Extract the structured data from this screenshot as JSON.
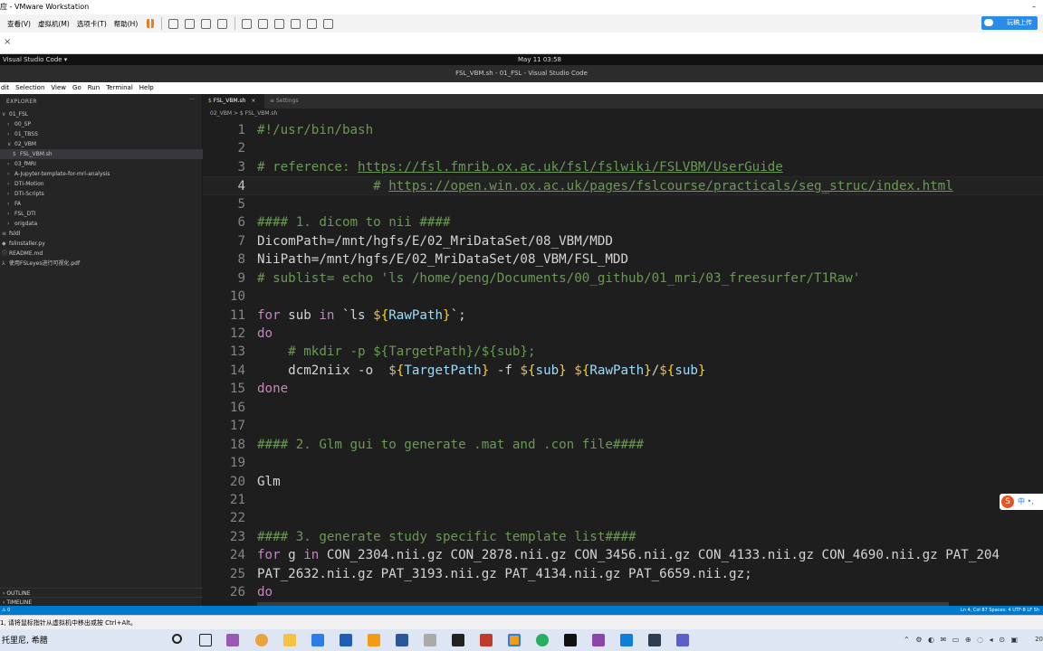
{
  "vmware": {
    "title": "应 - VMware Workstation",
    "menus": [
      "查看(V)",
      "虚拟机(M)",
      "选项卡(T)",
      "帮助(H)"
    ],
    "upload_label": "玩稿上传",
    "minimize": "–",
    "status_text": "1, 请将鼠标指针从虚拟机中移出或按 Ctrl+Alt。",
    "close_tab": "×"
  },
  "gnome": {
    "app": "Visual Studio Code ▾",
    "clock": "May 11  03:58"
  },
  "vscode": {
    "window_title": "FSL_VBM.sh - 01_FSL - Visual Studio Code",
    "menu": [
      "dit",
      "Selection",
      "View",
      "Go",
      "Run",
      "Terminal",
      "Help"
    ],
    "explorer_title": "EXPLORER",
    "explorer_more": "···",
    "tree": [
      {
        "chev": "∨",
        "label": "01_FSL",
        "indent": 0,
        "selected": false
      },
      {
        "chev": "›",
        "label": "00_SP",
        "indent": 1,
        "selected": false
      },
      {
        "chev": "›",
        "label": "01_TBSS",
        "indent": 1,
        "selected": false
      },
      {
        "chev": "∨",
        "label": "02_VBM",
        "indent": 1,
        "selected": false
      },
      {
        "chev": "$",
        "label": "FSL_VBM.sh",
        "indent": 2,
        "selected": true
      },
      {
        "chev": "›",
        "label": "03_fMRI",
        "indent": 1,
        "selected": false
      },
      {
        "chev": "›",
        "label": "A-Jupyter-template-for-mri-analysis",
        "indent": 1,
        "selected": false
      },
      {
        "chev": "›",
        "label": "DTI-Motion",
        "indent": 1,
        "selected": false
      },
      {
        "chev": "›",
        "label": "DTI-Scripts",
        "indent": 1,
        "selected": false
      },
      {
        "chev": "›",
        "label": "FA",
        "indent": 1,
        "selected": false
      },
      {
        "chev": "›",
        "label": "FSL_DTI",
        "indent": 1,
        "selected": false
      },
      {
        "chev": "›",
        "label": "origdata",
        "indent": 1,
        "selected": false
      },
      {
        "chev": "≡",
        "label": "fsldl",
        "indent": 0,
        "selected": false
      },
      {
        "chev": "◆",
        "label": "fslinstaller.py",
        "indent": 0,
        "selected": false
      },
      {
        "chev": "ⓘ",
        "label": "README.md",
        "indent": 0,
        "selected": false
      },
      {
        "chev": "⅄",
        "label": "使用FSLeyes进行可视化.pdf",
        "indent": 0,
        "selected": false
      }
    ],
    "outline_label": "OUTLINE",
    "timeline_label": "TIMELINE",
    "tabs": [
      {
        "label": "FSL_VBM.sh",
        "close": "×"
      },
      {
        "label": "Settings"
      }
    ],
    "breadcrumb": "02_VBM  >  $  FSL_VBM.sh",
    "statusbar": {
      "left": "⚠ 0",
      "right": "Ln 4, Col 87    Spaces: 4    UTF-8    LF    Sh"
    },
    "lines": [
      {
        "n": "1",
        "t": "#!/usr/bin/bash"
      },
      {
        "n": "2",
        "t": ""
      },
      {
        "n": "3",
        "t": "# reference: https://fsl.fmrib.ox.ac.uk/fsl/fslwiki/FSLVBM/UserGuide"
      },
      {
        "n": "4",
        "t": "               # https://open.win.ox.ac.uk/pages/fslcourse/practicals/seg_struc/index.html"
      },
      {
        "n": "5",
        "t": ""
      },
      {
        "n": "6",
        "t": "#### 1. dicom to nii ####"
      },
      {
        "n": "7",
        "t": "DicomPath=/mnt/hgfs/E/02_MriDataSet/08_VBM/MDD"
      },
      {
        "n": "8",
        "t": "NiiPath=/mnt/hgfs/E/02_MriDataSet/08_VBM/FSL_MDD"
      },
      {
        "n": "9",
        "t": "# sublist= echo 'ls /home/peng/Documents/00_github/01_mri/03_freesurfer/T1Raw'"
      },
      {
        "n": "10",
        "t": ""
      },
      {
        "n": "11",
        "t": "for sub in `ls ${RawPath}`;"
      },
      {
        "n": "12",
        "t": "do"
      },
      {
        "n": "13",
        "t": "    # mkdir -p ${TargetPath}/${sub};"
      },
      {
        "n": "14",
        "t": "    dcm2niix -o  ${TargetPath} -f ${sub} ${RawPath}/${sub}"
      },
      {
        "n": "15",
        "t": "done"
      },
      {
        "n": "16",
        "t": ""
      },
      {
        "n": "17",
        "t": ""
      },
      {
        "n": "18",
        "t": "#### 2. Glm gui to generate .mat and .con file####"
      },
      {
        "n": "19",
        "t": ""
      },
      {
        "n": "20",
        "t": "Glm"
      },
      {
        "n": "21",
        "t": ""
      },
      {
        "n": "22",
        "t": ""
      },
      {
        "n": "23",
        "t": "#### 3. generate study specific template list####"
      },
      {
        "n": "24",
        "t": "for g in CON_2304.nii.gz CON_2878.nii.gz CON_3456.nii.gz CON_4133.nii.gz CON_4690.nii.gz PAT_204"
      },
      {
        "n": "25",
        "t": "PAT_2632.nii.gz PAT_3193.nii.gz PAT_4134.nii.gz PAT_6659.nii.gz;"
      },
      {
        "n": "26",
        "t": "do"
      }
    ],
    "current_line": "4"
  },
  "ime": {
    "logo": "S",
    "label": "中 •,"
  },
  "taskbar": {
    "left_text": "托里尼, 希腊",
    "tray": "⌃ ⚙ ◐ ✉ ▭ ⊕ ◌ ◂ ⊙ ▣",
    "clock": "20"
  },
  "colors": {
    "accent": "#007acc",
    "keyword": "#c586c0",
    "variable": "#9cdcfe",
    "comment": "#6a9955",
    "bracket": "#ffd700"
  }
}
